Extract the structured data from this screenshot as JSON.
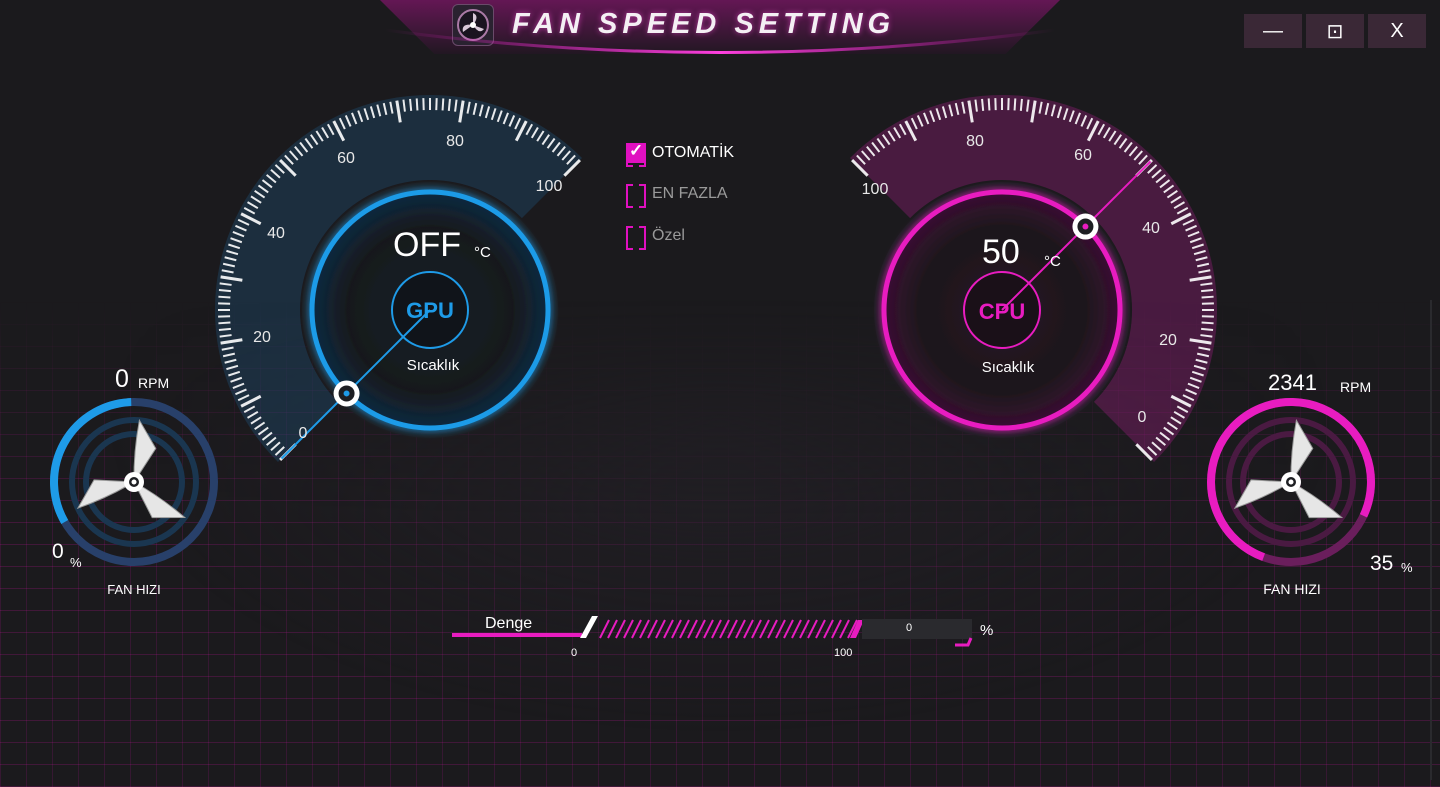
{
  "app": {
    "title": "FAN SPEED SETTING"
  },
  "window_controls": {
    "minimize": "—",
    "maximize": "⊡",
    "close": "X"
  },
  "gpu": {
    "chip_label": "GPU",
    "temperature": "OFF",
    "temp_unit": "°C",
    "sensor_label": "Sıcaklık",
    "gauge_ticks": [
      "0",
      "20",
      "40",
      "60",
      "80",
      "100"
    ],
    "needle_value": 0,
    "fan": {
      "rpm": "0",
      "rpm_unit": "RPM",
      "percent": "0",
      "percent_unit": "%",
      "label": "FAN HIZI",
      "level": 0.0
    }
  },
  "cpu": {
    "chip_label": "CPU",
    "temperature": "50",
    "temp_unit": "°C",
    "sensor_label": "Sıcaklık",
    "gauge_ticks": [
      "0",
      "20",
      "40",
      "60",
      "80",
      "100"
    ],
    "needle_value": 50,
    "fan": {
      "rpm": "2341",
      "rpm_unit": "RPM",
      "percent": "35",
      "percent_unit": "%",
      "label": "FAN HIZI",
      "level": 0.35
    }
  },
  "modes": [
    {
      "label": "OTOMATİK",
      "checked": true
    },
    {
      "label": "EN FAZLA",
      "checked": false
    },
    {
      "label": "Özel",
      "checked": false
    }
  ],
  "slider": {
    "label": "Denge",
    "min_label": "0",
    "max_label": "100",
    "value": "0",
    "unit": "%"
  },
  "colors": {
    "gpu_accent": "#1e9be8",
    "cpu_accent": "#e81cc0",
    "background": "#1b1a1d"
  },
  "icons": [
    "app-logo-icon",
    "minimize-icon",
    "maximize-icon",
    "close-icon",
    "gpu-fan-icon",
    "cpu-fan-icon",
    "checkbox-icon"
  ]
}
